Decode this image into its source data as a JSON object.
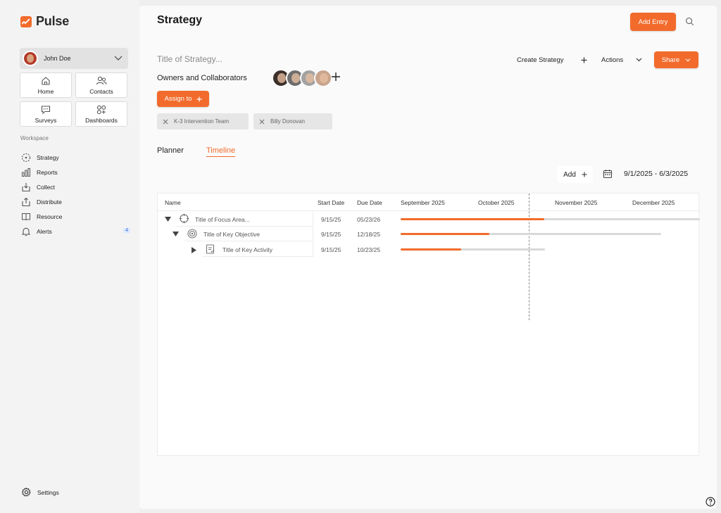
{
  "app": {
    "name": "Pulse",
    "colors": {
      "accent": "#f26b2c",
      "sidebar_bg": "#f3f3f3",
      "main_bg": "#fafafa"
    }
  },
  "sidebar": {
    "user": {
      "name": "John Doe",
      "avatar_icon": "user-avatar"
    },
    "quick_links": [
      {
        "label": "Home",
        "icon": "home-icon"
      },
      {
        "label": "Contacts",
        "icon": "contacts-icon"
      },
      {
        "label": "Surveys",
        "icon": "chat-icon"
      },
      {
        "label": "Dashboards",
        "icon": "dashboards-icon"
      }
    ],
    "section_label": "Workspace",
    "nav": [
      {
        "label": "Strategy",
        "icon": "strategy-icon"
      },
      {
        "label": "Reports",
        "icon": "bar-chart-icon"
      },
      {
        "label": "Collect",
        "icon": "collect-icon"
      },
      {
        "label": "Distribute",
        "icon": "distribute-icon"
      },
      {
        "label": "Resource",
        "icon": "book-icon"
      },
      {
        "label": "Alerts",
        "icon": "bell-icon",
        "badge": "4"
      }
    ],
    "settings_label": "Settings"
  },
  "header": {
    "title": "Strategy",
    "add_entry_label": "Add Entry"
  },
  "strategy": {
    "title_placeholder": "Title of Strategy...",
    "create_label": "Create Strategy",
    "actions_label": "Actions",
    "share_label": "Share",
    "owners_label": "Owners and Collaborators",
    "assign_label": "Assign to",
    "assignees": [
      "K-3 Intervention Team",
      "Billy Donovan"
    ]
  },
  "tabs": [
    {
      "label": "Planner",
      "active": false
    },
    {
      "label": "Timeline",
      "active": true
    }
  ],
  "timeline": {
    "add_label": "Add",
    "date_range": "9/1/2025 - 6/3/2025",
    "columns": [
      "Name",
      "Start Date",
      "Due Date"
    ],
    "months": [
      "September 2025",
      "October 2025",
      "November 2025",
      "December 2025"
    ],
    "rows": [
      {
        "name": "Title of Focus Area...",
        "start": "9/15/25",
        "due": "05/23/26",
        "progress": 0.48,
        "level": 0,
        "icon": "crosshair-icon"
      },
      {
        "name": "Title of Key Objective",
        "start": "9/15/25",
        "due": "12/18/25",
        "progress": 0.34,
        "level": 1,
        "icon": "target-icon"
      },
      {
        "name": "Title of Key Activity",
        "start": "9/15/25",
        "due": "10/23/25",
        "progress": 0.42,
        "level": 2,
        "icon": "clipboard-icon"
      }
    ]
  }
}
